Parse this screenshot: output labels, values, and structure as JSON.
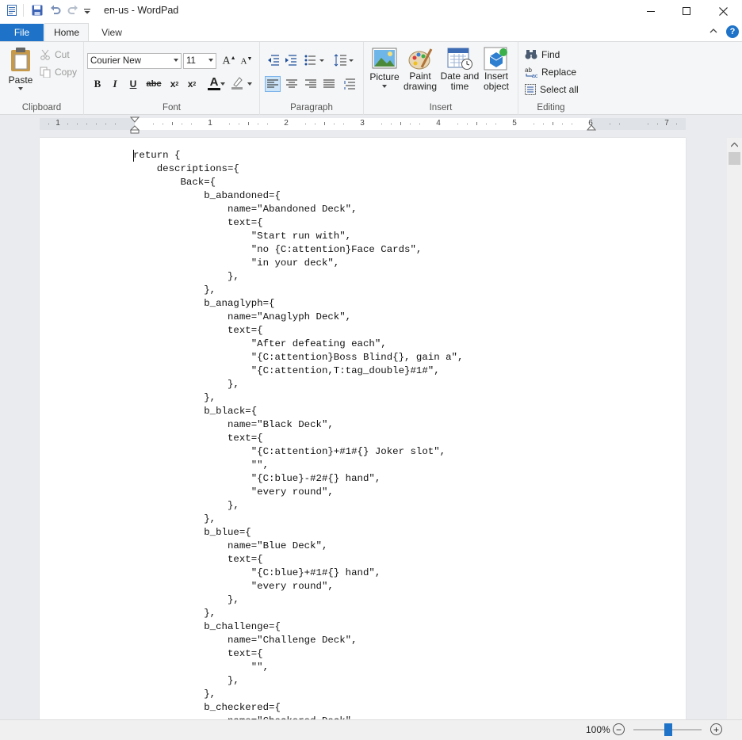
{
  "window": {
    "title": "en-us - WordPad",
    "icons": [
      "wordpad-app-icon",
      "save-icon",
      "undo-icon",
      "redo-icon",
      "customize-qat-icon",
      "minimize-icon",
      "maximize-icon",
      "close-icon"
    ]
  },
  "tabs": {
    "file": "File",
    "home": "Home",
    "view": "View"
  },
  "clipboard": {
    "group": "Clipboard",
    "paste": "Paste",
    "cut": "Cut",
    "copy": "Copy"
  },
  "font": {
    "group": "Font",
    "family": "Courier New",
    "size": "11",
    "bold": "B",
    "italic": "I",
    "underline": "U",
    "strike": "abc",
    "sub": "x",
    "sup": "x",
    "color_letter": "A"
  },
  "paragraph": {
    "group": "Paragraph"
  },
  "insert": {
    "group": "Insert",
    "picture": "Picture",
    "paint": "Paint drawing",
    "datetime": "Date and time",
    "object": "Insert object"
  },
  "editing": {
    "group": "Editing",
    "find": "Find",
    "replace": "Replace",
    "select_all": "Select all"
  },
  "ruler": {
    "numbers": [
      "1",
      "1",
      "2",
      "3",
      "4",
      "5",
      "6",
      "7"
    ]
  },
  "document": {
    "lines": [
      "return {",
      "    descriptions={",
      "        Back={",
      "            b_abandoned={",
      "                name=\"Abandoned Deck\",",
      "                text={",
      "                    \"Start run with\",",
      "                    \"no {C:attention}Face Cards\",",
      "                    \"in your deck\",",
      "                },",
      "            },",
      "            b_anaglyph={",
      "                name=\"Anaglyph Deck\",",
      "                text={",
      "                    \"After defeating each\",",
      "                    \"{C:attention}Boss Blind{}, gain a\",",
      "                    \"{C:attention,T:tag_double}#1#\",",
      "                },",
      "            },",
      "            b_black={",
      "                name=\"Black Deck\",",
      "                text={",
      "                    \"{C:attention}+#1#{} Joker slot\",",
      "                    \"\",",
      "                    \"{C:blue}-#2#{} hand\",",
      "                    \"every round\",",
      "                },",
      "            },",
      "            b_blue={",
      "                name=\"Blue Deck\",",
      "                text={",
      "                    \"{C:blue}+#1#{} hand\",",
      "                    \"every round\",",
      "                },",
      "            },",
      "            b_challenge={",
      "                name=\"Challenge Deck\",",
      "                text={",
      "                    \"\",",
      "                },",
      "            },",
      "            b_checkered={",
      "                name=\"Checkered Deck\","
    ]
  },
  "status": {
    "zoom": "100%",
    "zoom_out": "−",
    "zoom_in": "+"
  },
  "colors": {
    "accent": "#1e73c8",
    "ribbon_bg": "#f5f6f7",
    "workspace_bg": "#e9ebee"
  }
}
